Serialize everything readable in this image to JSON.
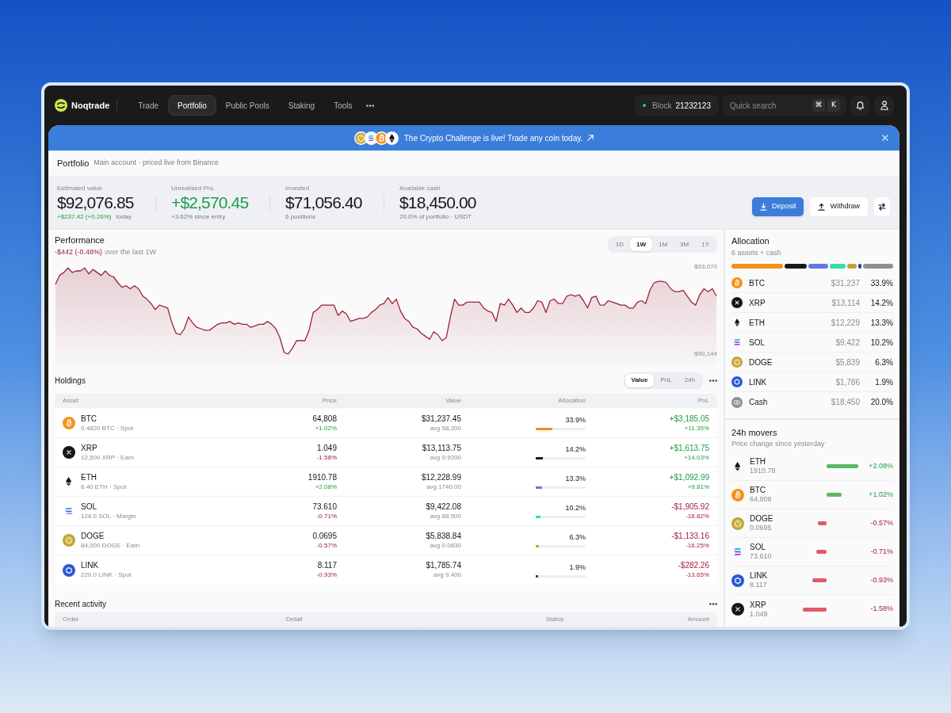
{
  "nav": {
    "brand": "Noqtrade",
    "items": [
      {
        "label": "Trade",
        "selected": false
      },
      {
        "label": "Portfolio",
        "selected": true
      },
      {
        "label": "Public Pools",
        "selected": false
      },
      {
        "label": "Staking",
        "selected": false
      },
      {
        "label": "Tools",
        "selected": false
      }
    ],
    "block": {
      "label": "Block",
      "number": "21232123"
    },
    "search": {
      "placeholder": "Quick search",
      "shortcut": [
        "⌘",
        "K"
      ]
    }
  },
  "banner": {
    "coins": [
      {
        "kind": "doge"
      },
      {
        "kind": "sol"
      },
      {
        "kind": "btc"
      },
      {
        "kind": "eth"
      }
    ],
    "text": "The Crypto Challenge is live! Trade any coin today."
  },
  "page_header": {
    "title": "Portfolio",
    "subtitle": "Main account · priced live from Binance"
  },
  "stats": [
    {
      "label": "Estimated value",
      "value": "$92,076.85",
      "highlight": false,
      "change": "+$237.42 (+0.26%)",
      "change_up": true,
      "note": "today"
    },
    {
      "label": "Unrealised PnL",
      "value": "+$2,570.45",
      "highlight": true,
      "note": "+3.62% since entry"
    },
    {
      "label": "Invested",
      "value": "$71,056.40",
      "highlight": false,
      "note": "6 positions"
    },
    {
      "label": "Available cash",
      "value": "$18,450.00",
      "highlight": false,
      "note": "20.0% of portfolio · USDT"
    }
  ],
  "actions": [
    {
      "kind": "deposit",
      "label": "Deposit",
      "primary": true
    },
    {
      "kind": "withdraw",
      "label": "Withdraw",
      "primary": false
    },
    {
      "kind": "swap",
      "primary": false
    }
  ],
  "performance": {
    "title": "Performance",
    "change": "-$442 (-0.48%)",
    "change_up": false,
    "note": "over the last 1W",
    "ranges": [
      {
        "label": "1D",
        "selected": false
      },
      {
        "label": "1W",
        "selected": true
      },
      {
        "label": "1M",
        "selected": false
      },
      {
        "label": "3M",
        "selected": false
      },
      {
        "label": "1Y",
        "selected": false
      }
    ],
    "chart_data": {
      "type": "area",
      "series": [
        {
          "color": "#9b2335",
          "values": [
            92500,
            92800,
            92900,
            93050,
            92900,
            92950,
            92950,
            93050,
            92850,
            93000,
            92900,
            92800,
            92950,
            92800,
            92750,
            92550,
            92400,
            92450,
            92350,
            92450,
            92350,
            92100,
            92000,
            91850,
            91650,
            91800,
            91750,
            91700,
            91200,
            90850,
            90800,
            91000,
            91400,
            91200,
            91050,
            91000,
            90950,
            90950,
            91050,
            91150,
            91200,
            91200,
            91250,
            91150,
            91200,
            91150,
            91150,
            91050,
            91100,
            91150,
            91150,
            91250,
            91150,
            91000,
            90700,
            90200,
            90150,
            90350,
            90600,
            90600,
            90600,
            90950,
            91550,
            91650,
            91800,
            91800,
            91800,
            91800,
            91450,
            91600,
            91500,
            91250,
            91300,
            91350,
            91350,
            91400,
            91550,
            91650,
            91800,
            91850,
            92050,
            91850,
            92000,
            91600,
            91350,
            91250,
            91050,
            91000,
            90850,
            90750,
            90650,
            90900,
            90800,
            90600,
            90700,
            91400,
            92000,
            91800,
            91800,
            91900,
            91900,
            91900,
            91900,
            91700,
            91600,
            91550,
            91250,
            91850,
            91800,
            92000,
            91800,
            91550,
            91700,
            91550,
            91550,
            91700,
            91950,
            91900,
            91550,
            91950,
            92000,
            91850,
            91850,
            92100,
            92150,
            92100,
            92150,
            91950,
            91700,
            92050,
            92100,
            91800,
            91800,
            91950,
            91900,
            91850,
            91800,
            91800,
            91700,
            91700,
            91900,
            91950,
            91850,
            92300,
            92550,
            92600,
            92600,
            92550,
            92350,
            92250,
            92250,
            92300,
            92100,
            91900,
            91800,
            92150,
            92350,
            92250,
            92350,
            92100
          ]
        }
      ],
      "ylim": [
        89800,
        93270
      ],
      "yticks": [
        {
          "value": 93070,
          "label": "$93,070"
        },
        {
          "value": 90144,
          "label": "$90,144"
        }
      ]
    }
  },
  "holdings": {
    "title": "Holdings",
    "views": [
      {
        "label": "Value",
        "selected": true
      },
      {
        "label": "PnL",
        "selected": false
      },
      {
        "label": "24h",
        "selected": false
      }
    ],
    "columns": [
      "Asset",
      "Price",
      "Value",
      "Allocation",
      "PnL"
    ],
    "rows": [
      {
        "kind": "btc",
        "symbol": "BTC",
        "detail": "0.4820 BTC · Spot",
        "price": "64,808",
        "change": "+1.02%",
        "change_up": true,
        "value": "$31,237.45",
        "avg": "avg 58,200",
        "allocation": "33.9%",
        "level": 0.339,
        "color": "#f39019",
        "pnl": "+$3,185.05",
        "pnl_percent": "+11.35%",
        "pnl_up": true
      },
      {
        "kind": "xrp",
        "symbol": "XRP",
        "detail": "12,500 XRP · Earn",
        "price": "1.049",
        "change": "-1.58%",
        "change_up": false,
        "value": "$13,113.75",
        "avg": "avg 0.9200",
        "allocation": "14.2%",
        "level": 0.142,
        "color": "#1a1a1a",
        "pnl": "+$1,613.75",
        "pnl_percent": "+14.03%",
        "pnl_up": true
      },
      {
        "kind": "eth",
        "symbol": "ETH",
        "detail": "6.40 ETH · Spot",
        "price": "1910.78",
        "change": "+2.08%",
        "change_up": true,
        "value": "$12,228.99",
        "avg": "avg 1740.00",
        "allocation": "13.3%",
        "level": 0.133,
        "color": "#6678dd",
        "pnl": "+$1,092.99",
        "pnl_percent": "+9.81%",
        "pnl_up": true
      },
      {
        "kind": "sol",
        "symbol": "SOL",
        "detail": "128.0 SOL · Margin",
        "price": "73.610",
        "change": "-0.71%",
        "change_up": false,
        "value": "$9,422.08",
        "avg": "avg 88.500",
        "allocation": "10.2%",
        "level": 0.102,
        "color": "#2fe0a2",
        "pnl": "-$1,905.92",
        "pnl_percent": "-16.82%",
        "pnl_up": false
      },
      {
        "kind": "doge",
        "symbol": "DOGE",
        "detail": "84,000 DOGE · Earn",
        "price": "0.0695",
        "change": "-0.57%",
        "change_up": false,
        "value": "$5,838.84",
        "avg": "avg 0.0830",
        "allocation": "6.3%",
        "level": 0.063,
        "color": "#c4a232",
        "pnl": "-$1,133.16",
        "pnl_percent": "-16.25%",
        "pnl_up": false
      },
      {
        "kind": "link",
        "symbol": "LINK",
        "detail": "220.0 LINK · Spot",
        "price": "8.117",
        "change": "-0.93%",
        "change_up": false,
        "value": "$1,785.74",
        "avg": "avg 9.400",
        "allocation": "1.9%",
        "level": 0.05,
        "color": "#243fa8",
        "pnl": "-$282.26",
        "pnl_percent": "-13.65%",
        "pnl_up": false
      }
    ]
  },
  "recent_activity": {
    "title": "Recent activity",
    "columns": [
      "Order",
      "Detail",
      "Status",
      "Amount"
    ]
  },
  "allocation": {
    "title": "Allocation",
    "subtitle": "6 assets + cash",
    "items": [
      {
        "kind": "btc",
        "symbol": "BTC",
        "value": "$31,237",
        "share": "33.9%",
        "color": "#f39019"
      },
      {
        "kind": "xrp",
        "symbol": "XRP",
        "value": "$13,114",
        "share": "14.2%",
        "color": "#1a1a1a"
      },
      {
        "kind": "eth",
        "symbol": "ETH",
        "value": "$12,229",
        "share": "13.3%",
        "color": "#6678dd"
      },
      {
        "kind": "sol",
        "symbol": "SOL",
        "value": "$9,422",
        "share": "10.2%",
        "color": "#2fe0a2"
      },
      {
        "kind": "doge",
        "symbol": "DOGE",
        "value": "$5,839",
        "share": "6.3%",
        "color": "#c4a232"
      },
      {
        "kind": "link",
        "symbol": "LINK",
        "value": "$1,786",
        "share": "1.9%",
        "color": "#243fa8"
      },
      {
        "kind": "cash",
        "symbol": "Cash",
        "value": "$18,450",
        "share": "20.0%",
        "color": "#8e8e93"
      }
    ]
  },
  "movers": {
    "title": "24h movers",
    "subtitle": "Price change since yesterday",
    "items": [
      {
        "kind": "eth",
        "symbol": "ETH",
        "price": "1910.78",
        "change": "+2.08%",
        "up": true
      },
      {
        "kind": "btc",
        "symbol": "BTC",
        "price": "64,808",
        "change": "+1.02%",
        "up": true
      },
      {
        "kind": "doge",
        "symbol": "DOGE",
        "price": "0.0695",
        "change": "-0.57%",
        "up": false
      },
      {
        "kind": "sol",
        "symbol": "SOL",
        "price": "73.610",
        "change": "-0.71%",
        "up": false
      },
      {
        "kind": "link",
        "symbol": "LINK",
        "price": "8.117",
        "change": "-0.93%",
        "up": false
      },
      {
        "kind": "xrp",
        "symbol": "XRP",
        "price": "1.049",
        "change": "-1.58%",
        "up": false
      }
    ]
  }
}
